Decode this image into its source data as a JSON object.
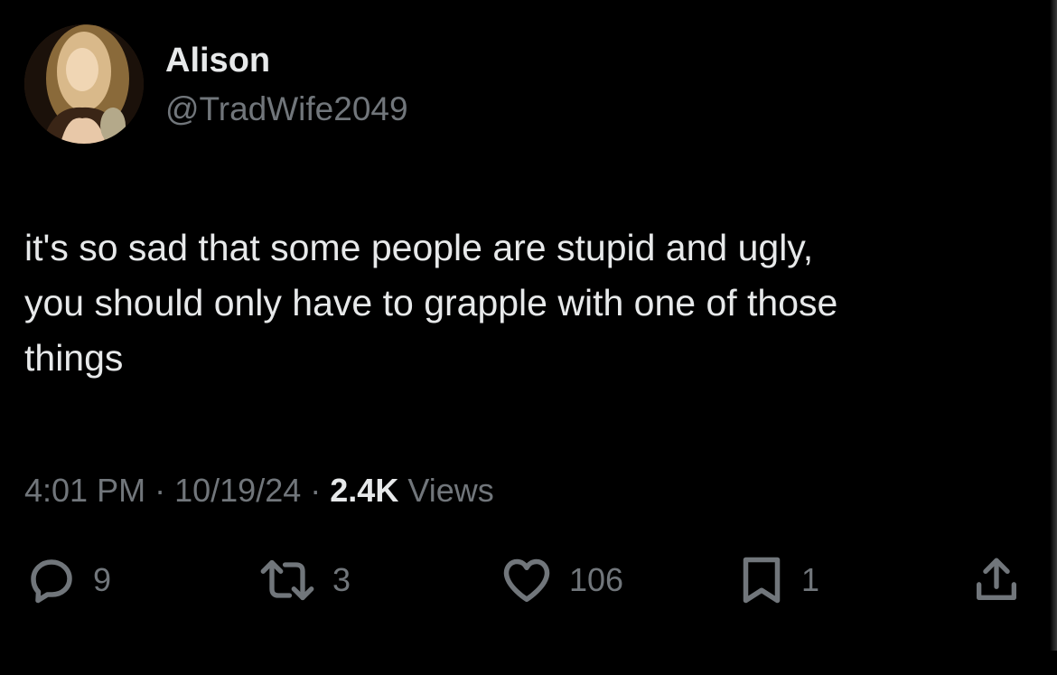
{
  "author": {
    "name": "Alison",
    "handle": "@TradWife2049"
  },
  "tweet": {
    "text": "it's so sad that some people are stupid and ugly,\nyou should only have to grapple with one of those\nthings",
    "time": "4:01 PM",
    "separator": "·",
    "date": "10/19/24",
    "views_count": "2.4K",
    "views_label": "Views"
  },
  "actions": {
    "replies": {
      "icon": "reply-icon",
      "count": "9"
    },
    "retweets": {
      "icon": "retweet-icon",
      "count": "3"
    },
    "likes": {
      "icon": "heart-icon",
      "count": "106"
    },
    "bookmarks": {
      "icon": "bookmark-icon",
      "count": "1"
    },
    "share": {
      "icon": "share-icon"
    }
  },
  "colors": {
    "background": "#000000",
    "primary_text": "#e7e9ea",
    "secondary_text": "#71767b"
  }
}
